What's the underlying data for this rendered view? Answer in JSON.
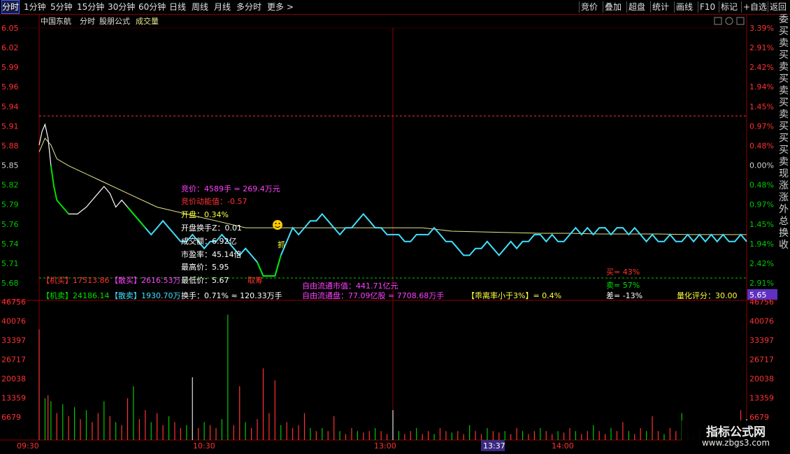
{
  "toolbar": {
    "left_tabs": [
      {
        "label": "分时",
        "active": true
      },
      {
        "label": "1分钟"
      },
      {
        "label": "5分钟"
      },
      {
        "label": "15分钟"
      },
      {
        "label": "30分钟"
      },
      {
        "label": "60分钟"
      },
      {
        "label": "日线"
      },
      {
        "label": "周线"
      },
      {
        "label": "月线"
      },
      {
        "label": "多分时"
      },
      {
        "label": "更多 >"
      }
    ],
    "right_tabs": [
      {
        "label": "竞价"
      },
      {
        "label": "叠加"
      },
      {
        "label": "超盘"
      },
      {
        "label": "统计"
      },
      {
        "label": "画线"
      },
      {
        "label": "F10"
      },
      {
        "label": "标记"
      },
      {
        "label": "+自选"
      },
      {
        "label": "返回"
      }
    ]
  },
  "header": {
    "stock_name": "中国东航",
    "mode": "分时",
    "formula": "股朋公式",
    "indicator": "成交量"
  },
  "price_axis": {
    "left_labels": [
      "6.05",
      "6.02",
      "5.99",
      "5.96",
      "5.94",
      "5.91",
      "5.88",
      "5.85",
      "5.82",
      "5.79",
      "5.76",
      "5.74",
      "5.71",
      "5.68"
    ],
    "right_labels": [
      "3.39%",
      "2.91%",
      "2.42%",
      "1.94%",
      "1.45%",
      "0.97%",
      "0.48%",
      "0.00%",
      "0.48%",
      "0.97%",
      "1.45%",
      "1.94%",
      "2.42%",
      "2.91%"
    ],
    "current_price_tag": "5.65",
    "colors": {
      "up": "#ff3232",
      "down": "#00c800",
      "neutral": "#d0d0d0"
    }
  },
  "volume_axis": {
    "labels": [
      "46756",
      "40076",
      "33397",
      "26717",
      "20038",
      "13359",
      "6679"
    ]
  },
  "time_axis": {
    "labels": [
      "09:30",
      "10:30",
      "13:00",
      "14:00"
    ],
    "cursor_time": "13:37"
  },
  "annotations": {
    "bid_price": "竞价：4589手 = 269.4万元",
    "bid_momentum": "竞价动能值：-0.57",
    "open_change": "开盘：0.34%",
    "open_turnover": "开盘换手Z：0.01",
    "turnover_amount": "成交额：6.92亿",
    "pe_ratio": "市盈率：45.14倍",
    "high_price": "最高价：5.95",
    "low_price": "最低价：5.67",
    "buy_chip_label": "取筹",
    "grab_label": "抓",
    "inst_buy": "【机买】17513.86",
    "retail_buy": "【散买】2616.53万",
    "inst_sell": "【机卖】24186.14",
    "retail_sell": "【散卖】1930.70万",
    "turnover_rate": "换手：0.71% ≈ 120.33万手",
    "free_float_cap": "自由流通市值：441.71亿元",
    "free_float_shares": "自由流通盘：77.09亿股 ≈ 7708.68万手",
    "ratio_note": "【乖离率小于3%】= 0.4%",
    "buy_pct": "买= 43%",
    "sell_pct": "卖= 57%",
    "diff_pct": "差= -13%",
    "quant_score": "量化评分：30.00",
    "emoji_icon": "smiley-icon"
  },
  "side_strip": {
    "chars": [
      "委",
      "买",
      "卖",
      "买",
      "卖",
      "买",
      "卖",
      "买",
      "卖",
      "买",
      "买",
      "买",
      "卖",
      "现",
      "涨",
      "涨",
      "外",
      "总",
      "换",
      "收"
    ]
  },
  "watermark": {
    "title": "指标公式网",
    "url": "www.zbgs3.com"
  },
  "chart_data": {
    "type": "line",
    "title": "",
    "xlabel": "",
    "ylabel": "",
    "ylim": [
      5.68,
      6.05
    ],
    "volume_ylim": [
      0,
      46756
    ],
    "grid": false,
    "x_range_minutes": [
      0,
      240
    ],
    "prev_close": 5.85,
    "price_series": [
      [
        0,
        5.88
      ],
      [
        1,
        5.9
      ],
      [
        2,
        5.91
      ],
      [
        3,
        5.89
      ],
      [
        4,
        5.85
      ],
      [
        5,
        5.82
      ],
      [
        6,
        5.8
      ],
      [
        8,
        5.79
      ],
      [
        10,
        5.78
      ],
      [
        13,
        5.78
      ],
      [
        16,
        5.79
      ],
      [
        18,
        5.8
      ],
      [
        20,
        5.81
      ],
      [
        22,
        5.82
      ],
      [
        24,
        5.81
      ],
      [
        26,
        5.79
      ],
      [
        28,
        5.8
      ],
      [
        30,
        5.79
      ],
      [
        32,
        5.78
      ],
      [
        34,
        5.77
      ],
      [
        36,
        5.76
      ],
      [
        38,
        5.75
      ],
      [
        40,
        5.76
      ],
      [
        42,
        5.77
      ],
      [
        44,
        5.76
      ],
      [
        46,
        5.75
      ],
      [
        48,
        5.74
      ],
      [
        50,
        5.74
      ],
      [
        52,
        5.75
      ],
      [
        54,
        5.74
      ],
      [
        56,
        5.73
      ],
      [
        58,
        5.74
      ],
      [
        60,
        5.74
      ],
      [
        62,
        5.75
      ],
      [
        64,
        5.74
      ],
      [
        66,
        5.73
      ],
      [
        68,
        5.72
      ],
      [
        70,
        5.73
      ],
      [
        72,
        5.72
      ],
      [
        74,
        5.71
      ],
      [
        76,
        5.69
      ],
      [
        78,
        5.69
      ],
      [
        80,
        5.69
      ],
      [
        82,
        5.72
      ],
      [
        84,
        5.74
      ],
      [
        86,
        5.76
      ],
      [
        88,
        5.75
      ],
      [
        90,
        5.76
      ],
      [
        92,
        5.77
      ],
      [
        94,
        5.77
      ],
      [
        96,
        5.78
      ],
      [
        98,
        5.77
      ],
      [
        100,
        5.76
      ],
      [
        102,
        5.75
      ],
      [
        104,
        5.76
      ],
      [
        106,
        5.76
      ],
      [
        108,
        5.77
      ],
      [
        110,
        5.78
      ],
      [
        112,
        5.77
      ],
      [
        114,
        5.76
      ],
      [
        116,
        5.76
      ],
      [
        118,
        5.75
      ],
      [
        120,
        5.75
      ],
      [
        122,
        5.75
      ],
      [
        124,
        5.74
      ],
      [
        126,
        5.74
      ],
      [
        128,
        5.75
      ],
      [
        130,
        5.75
      ],
      [
        132,
        5.75
      ],
      [
        134,
        5.76
      ],
      [
        136,
        5.75
      ],
      [
        138,
        5.74
      ],
      [
        140,
        5.74
      ],
      [
        142,
        5.73
      ],
      [
        144,
        5.72
      ],
      [
        146,
        5.72
      ],
      [
        148,
        5.73
      ],
      [
        150,
        5.73
      ],
      [
        152,
        5.74
      ],
      [
        154,
        5.73
      ],
      [
        156,
        5.72
      ],
      [
        158,
        5.73
      ],
      [
        160,
        5.74
      ],
      [
        162,
        5.73
      ],
      [
        164,
        5.74
      ],
      [
        166,
        5.74
      ],
      [
        168,
        5.75
      ],
      [
        170,
        5.75
      ],
      [
        172,
        5.74
      ],
      [
        174,
        5.75
      ],
      [
        176,
        5.74
      ],
      [
        178,
        5.74
      ],
      [
        180,
        5.75
      ],
      [
        182,
        5.76
      ],
      [
        184,
        5.75
      ],
      [
        186,
        5.76
      ],
      [
        188,
        5.75
      ],
      [
        190,
        5.76
      ],
      [
        192,
        5.76
      ],
      [
        194,
        5.75
      ],
      [
        196,
        5.76
      ],
      [
        198,
        5.76
      ],
      [
        200,
        5.75
      ],
      [
        202,
        5.76
      ],
      [
        204,
        5.75
      ],
      [
        206,
        5.74
      ],
      [
        208,
        5.75
      ],
      [
        210,
        5.74
      ],
      [
        212,
        5.74
      ],
      [
        214,
        5.75
      ],
      [
        216,
        5.74
      ],
      [
        218,
        5.74
      ],
      [
        220,
        5.75
      ],
      [
        222,
        5.74
      ],
      [
        224,
        5.75
      ],
      [
        226,
        5.74
      ],
      [
        228,
        5.75
      ],
      [
        230,
        5.74
      ],
      [
        232,
        5.75
      ],
      [
        234,
        5.74
      ],
      [
        236,
        5.74
      ],
      [
        238,
        5.75
      ],
      [
        240,
        5.74
      ]
    ],
    "avg_series": [
      [
        0,
        5.87
      ],
      [
        2,
        5.89
      ],
      [
        4,
        5.88
      ],
      [
        6,
        5.86
      ],
      [
        10,
        5.85
      ],
      [
        15,
        5.84
      ],
      [
        20,
        5.83
      ],
      [
        30,
        5.81
      ],
      [
        40,
        5.79
      ],
      [
        50,
        5.78
      ],
      [
        60,
        5.77
      ],
      [
        70,
        5.76
      ],
      [
        80,
        5.76
      ],
      [
        90,
        5.76
      ],
      [
        100,
        5.76
      ],
      [
        110,
        5.76
      ],
      [
        120,
        5.76
      ],
      [
        130,
        5.76
      ],
      [
        140,
        5.755
      ],
      [
        150,
        5.754
      ],
      [
        160,
        5.753
      ],
      [
        170,
        5.752
      ],
      [
        180,
        5.752
      ],
      [
        190,
        5.751
      ],
      [
        200,
        5.751
      ],
      [
        210,
        5.751
      ],
      [
        220,
        5.75
      ],
      [
        230,
        5.75
      ],
      [
        240,
        5.75
      ]
    ],
    "volume_series": [
      [
        0,
        37000,
        "up"
      ],
      [
        2,
        14000,
        "down"
      ],
      [
        3,
        15000,
        "up"
      ],
      [
        4,
        13000,
        "down"
      ],
      [
        6,
        9000,
        "up"
      ],
      [
        8,
        12000,
        "down"
      ],
      [
        10,
        8000,
        "up"
      ],
      [
        12,
        11000,
        "down"
      ],
      [
        14,
        7000,
        "up"
      ],
      [
        16,
        10000,
        "down"
      ],
      [
        18,
        6000,
        "up"
      ],
      [
        20,
        9000,
        "up"
      ],
      [
        22,
        13000,
        "down"
      ],
      [
        24,
        8000,
        "up"
      ],
      [
        26,
        6000,
        "down"
      ],
      [
        28,
        5000,
        "up"
      ],
      [
        30,
        14000,
        "up"
      ],
      [
        32,
        18000,
        "down"
      ],
      [
        34,
        7000,
        "up"
      ],
      [
        36,
        10000,
        "up"
      ],
      [
        38,
        6000,
        "down"
      ],
      [
        40,
        9000,
        "up"
      ],
      [
        42,
        5000,
        "up"
      ],
      [
        44,
        8000,
        "down"
      ],
      [
        46,
        6000,
        "up"
      ],
      [
        48,
        4000,
        "up"
      ],
      [
        50,
        5000,
        "down"
      ],
      [
        52,
        21000,
        "neutral"
      ],
      [
        54,
        4000,
        "up"
      ],
      [
        56,
        6000,
        "down"
      ],
      [
        58,
        5000,
        "up"
      ],
      [
        60,
        4000,
        "up"
      ],
      [
        62,
        7000,
        "down"
      ],
      [
        64,
        42000,
        "down"
      ],
      [
        66,
        5000,
        "up"
      ],
      [
        68,
        18000,
        "up"
      ],
      [
        70,
        6000,
        "down"
      ],
      [
        72,
        4000,
        "up"
      ],
      [
        74,
        7000,
        "up"
      ],
      [
        76,
        24000,
        "up"
      ],
      [
        78,
        9000,
        "up"
      ],
      [
        80,
        20000,
        "up"
      ],
      [
        82,
        5000,
        "down"
      ],
      [
        84,
        6000,
        "up"
      ],
      [
        86,
        4000,
        "up"
      ],
      [
        88,
        5000,
        "up"
      ],
      [
        90,
        9000,
        "up"
      ],
      [
        92,
        4000,
        "down"
      ],
      [
        94,
        3000,
        "up"
      ],
      [
        96,
        4000,
        "down"
      ],
      [
        98,
        3000,
        "up"
      ],
      [
        100,
        8000,
        "up"
      ],
      [
        102,
        3000,
        "down"
      ],
      [
        104,
        2000,
        "up"
      ],
      [
        106,
        4000,
        "up"
      ],
      [
        108,
        3000,
        "down"
      ],
      [
        110,
        2500,
        "up"
      ],
      [
        112,
        3000,
        "up"
      ],
      [
        114,
        4000,
        "down"
      ],
      [
        116,
        3000,
        "up"
      ],
      [
        118,
        2000,
        "up"
      ],
      [
        120,
        10000,
        "neutral"
      ],
      [
        122,
        3000,
        "down"
      ],
      [
        124,
        2000,
        "up"
      ],
      [
        126,
        3000,
        "up"
      ],
      [
        128,
        4000,
        "down"
      ],
      [
        130,
        2000,
        "up"
      ],
      [
        132,
        3000,
        "up"
      ],
      [
        134,
        2000,
        "down"
      ],
      [
        136,
        4000,
        "up"
      ],
      [
        138,
        3000,
        "up"
      ],
      [
        140,
        2500,
        "down"
      ],
      [
        142,
        3000,
        "up"
      ],
      [
        144,
        2000,
        "up"
      ],
      [
        146,
        5000,
        "down"
      ],
      [
        148,
        3000,
        "up"
      ],
      [
        150,
        2000,
        "up"
      ],
      [
        152,
        4000,
        "down"
      ],
      [
        154,
        3000,
        "up"
      ],
      [
        156,
        2500,
        "up"
      ],
      [
        158,
        3000,
        "down"
      ],
      [
        160,
        2000,
        "up"
      ],
      [
        162,
        4000,
        "up"
      ],
      [
        164,
        3000,
        "down"
      ],
      [
        166,
        2000,
        "up"
      ],
      [
        168,
        3000,
        "up"
      ],
      [
        170,
        4000,
        "down"
      ],
      [
        172,
        3000,
        "up"
      ],
      [
        174,
        2000,
        "up"
      ],
      [
        176,
        3000,
        "down"
      ],
      [
        178,
        2500,
        "up"
      ],
      [
        180,
        4000,
        "up"
      ],
      [
        182,
        3000,
        "down"
      ],
      [
        184,
        2000,
        "up"
      ],
      [
        186,
        3000,
        "up"
      ],
      [
        188,
        5000,
        "down"
      ],
      [
        190,
        3000,
        "up"
      ],
      [
        192,
        2000,
        "up"
      ],
      [
        194,
        4000,
        "down"
      ],
      [
        196,
        3000,
        "up"
      ],
      [
        198,
        6000,
        "up"
      ],
      [
        200,
        3000,
        "down"
      ],
      [
        202,
        2000,
        "up"
      ],
      [
        204,
        4000,
        "up"
      ],
      [
        206,
        3000,
        "down"
      ],
      [
        208,
        8000,
        "up"
      ],
      [
        210,
        3000,
        "up"
      ],
      [
        212,
        2000,
        "down"
      ],
      [
        214,
        4000,
        "up"
      ],
      [
        216,
        3000,
        "up"
      ],
      [
        218,
        9000,
        "down"
      ],
      [
        220,
        3000,
        "up"
      ],
      [
        222,
        2000,
        "up"
      ],
      [
        224,
        4000,
        "down"
      ],
      [
        226,
        3000,
        "up"
      ],
      [
        228,
        5000,
        "up"
      ],
      [
        230,
        4000,
        "down"
      ],
      [
        232,
        3000,
        "up"
      ],
      [
        234,
        6000,
        "up"
      ],
      [
        236,
        4000,
        "down"
      ],
      [
        238,
        10000,
        "up"
      ],
      [
        240,
        7000,
        "neutral"
      ]
    ],
    "segment_colors": {
      "price_early": "#ffffff",
      "price_low": "#00e000",
      "price_late": "#40e0ff",
      "avg": "#e6e68c"
    }
  }
}
